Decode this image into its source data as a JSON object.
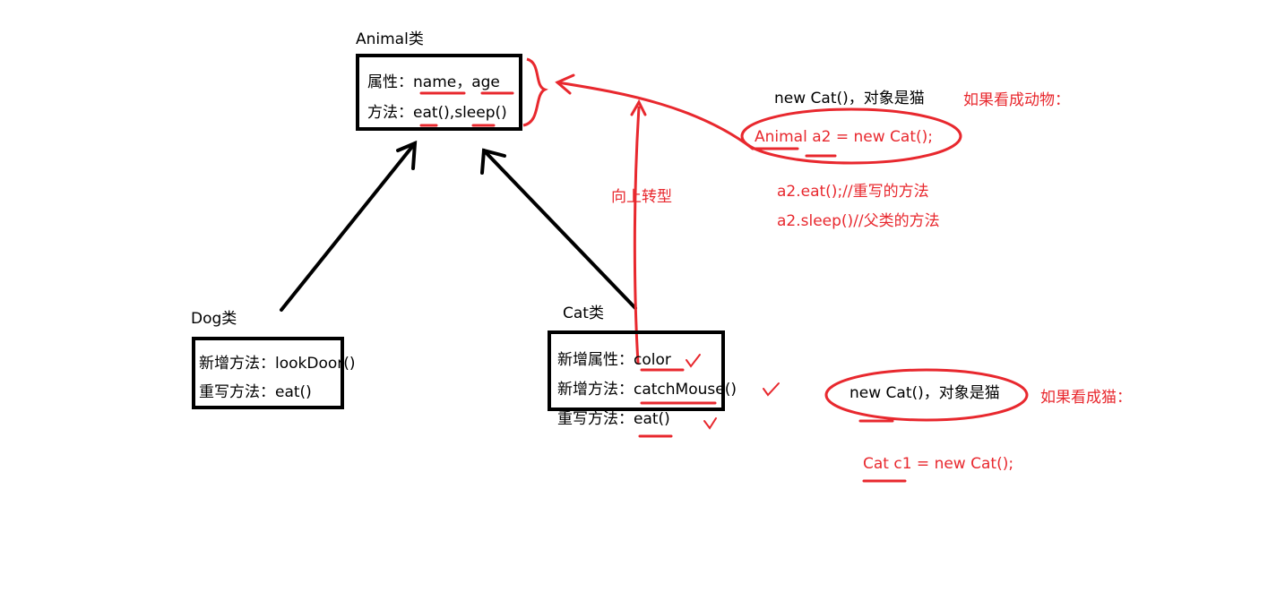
{
  "colors": {
    "ink": "#000000",
    "annotation": "#e8282e",
    "background": "#ffffff"
  },
  "animal": {
    "title": "Animal类",
    "attr_line": "属性：name，age",
    "method_line": "方法：eat(),sleep()"
  },
  "dog": {
    "title": "Dog类",
    "line1": "新增方法：lookDoor()",
    "line2": "重写方法：eat()"
  },
  "cat": {
    "title": "Cat类",
    "line1": "新增属性：color",
    "line2": "新增方法：catchMouse()",
    "line3": "重写方法：eat()"
  },
  "upcast_label": "向上转型",
  "as_animal": {
    "new_obj": "new Cat()，对象是猫",
    "heading": "如果看成动物：",
    "decl": "Animal a2 = new Cat();",
    "call1": "a2.eat();//重写的方法",
    "call2": "a2.sleep()//父类的方法"
  },
  "as_cat": {
    "new_obj": "new Cat()，对象是猫",
    "heading": "如果看成猫：",
    "decl": "Cat c1 = new Cat();"
  },
  "check_mark": "√"
}
